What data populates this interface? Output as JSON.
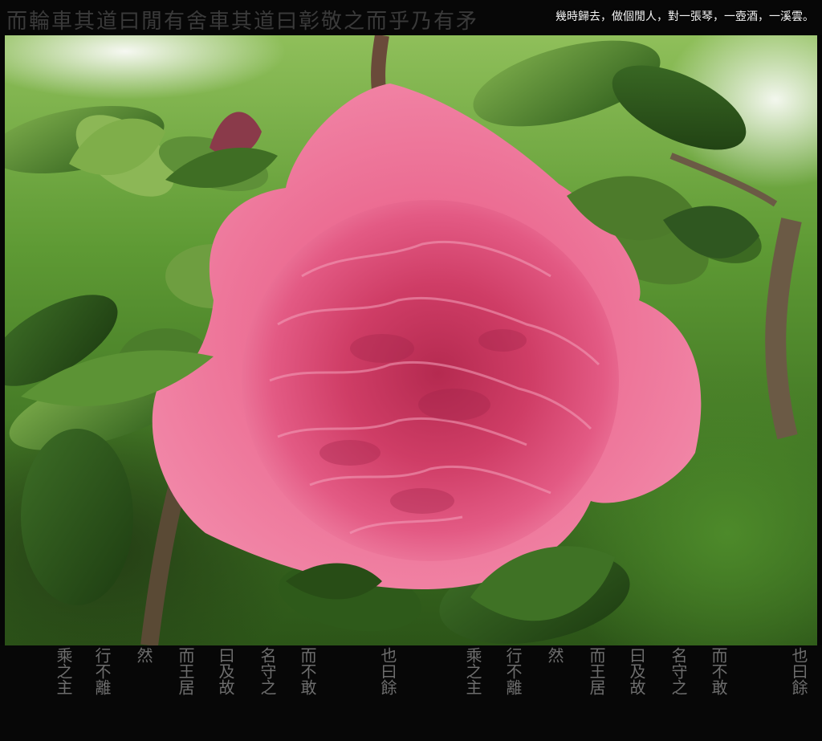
{
  "poem": "幾時歸去，做個閒人，對一張琴，一壺酒，一溪雲。",
  "top_calligraphy": "而輪車其道曰閒有舍車其道曰彰敬之而乎乃有矛",
  "bottom_calligraphy": [
    "乘之主",
    "行不離",
    "然",
    "而王居",
    "曰及故",
    "名守之",
    "而不敢",
    "也曰餘",
    "乘之主",
    "行不離",
    "然",
    "而王居",
    "曰及故",
    "名守之",
    "而不敢",
    "也曰餘"
  ],
  "colors": {
    "frame": "#060606",
    "poem_text": "#f4f4f4",
    "petal_outer": "#e8638a",
    "petal_inner": "#c8375e",
    "leaf": "#4e8a2c"
  }
}
